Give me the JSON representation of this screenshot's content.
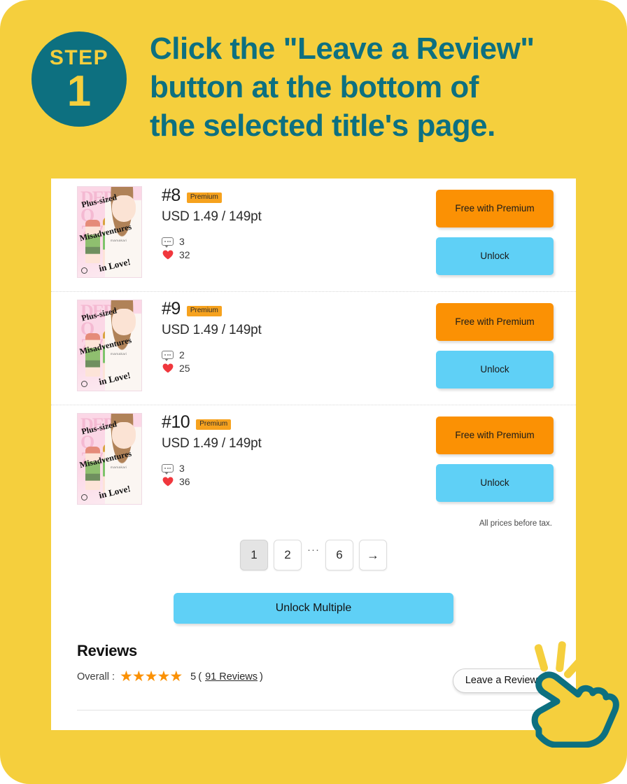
{
  "header": {
    "step_word": "STEP",
    "step_number": "1",
    "headline_lines": [
      "Click the \"Leave a Review\"",
      "button at the bottom of",
      "the selected title's page."
    ],
    "badge_color": "#0D7080",
    "background_color": "#F5CF3D"
  },
  "cover": {
    "title_line1": "Plus-sized",
    "title_line2": "Misadventures",
    "title_line3": "in Love!",
    "artist": "mamakari"
  },
  "chapters": [
    {
      "number": "#8",
      "badge": "Premium",
      "price": "USD 1.49 / 149pt",
      "comments": "3",
      "likes": "32",
      "premium_button": "Free with Premium",
      "unlock_button": "Unlock"
    },
    {
      "number": "#9",
      "badge": "Premium",
      "price": "USD 1.49 / 149pt",
      "comments": "2",
      "likes": "25",
      "premium_button": "Free with Premium",
      "unlock_button": "Unlock"
    },
    {
      "number": "#10",
      "badge": "Premium",
      "price": "USD 1.49 / 149pt",
      "comments": "3",
      "likes": "36",
      "premium_button": "Free with Premium",
      "unlock_button": "Unlock"
    }
  ],
  "tax_note": "All prices before tax.",
  "pagination": {
    "pages": [
      "1",
      "2"
    ],
    "ellipsis": "···",
    "last_page": "6",
    "next_arrow": "→",
    "active_page": "1"
  },
  "unlock_multiple_label": "Unlock Multiple",
  "reviews": {
    "title": "Reviews",
    "overall_label": "Overall :",
    "stars_filled": 5,
    "score": "5",
    "open_paren": "(",
    "count_link": "91 Reviews",
    "close_paren": ")",
    "leave_review_label": "Leave a Review"
  },
  "colors": {
    "premium_button": "#FB9104",
    "unlock_button": "#5FD0F6",
    "premium_badge": "#F6A21E",
    "star": "#FB9104",
    "heart": "#F0373D",
    "teal": "#0D7080",
    "yellow": "#F5CF3D"
  }
}
